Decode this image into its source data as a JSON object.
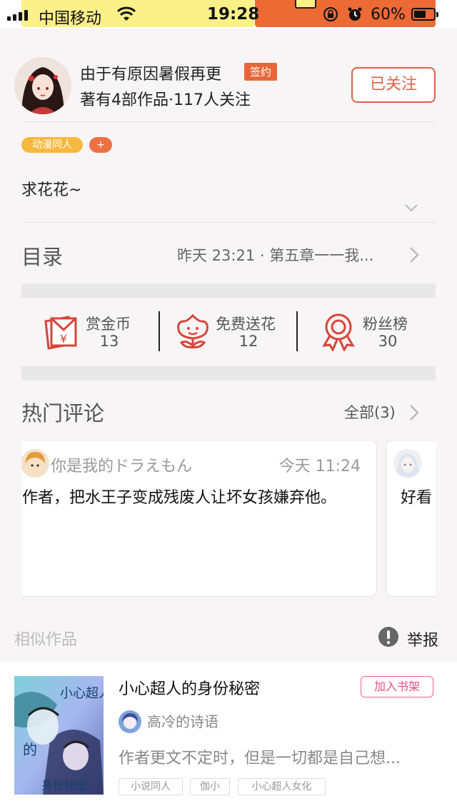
{
  "status_bar": {
    "carrier": "中国移动",
    "time": "19:28",
    "battery": "60%",
    "battery_level": 0.6
  },
  "author": {
    "name": "由于有原因暑假再更",
    "badge": "签约",
    "stats": "著有4部作品·117人关注",
    "follow_label": "已关注"
  },
  "tags": [
    "动漫同人",
    "+"
  ],
  "description": "求花花~",
  "toc": {
    "title": "目录",
    "latest": "昨天 23:21 · 第五章一一我..."
  },
  "actions": [
    {
      "icon": "red-envelope-icon",
      "label": "赏金币",
      "value": "13"
    },
    {
      "icon": "flower-icon",
      "label": "免费送花",
      "value": "12"
    },
    {
      "icon": "medal-icon",
      "label": "粉丝榜",
      "value": "30"
    }
  ],
  "hot_comments": {
    "title": "热门评论",
    "all_label": "全部(3)",
    "items": [
      {
        "user": "你是我的ドラえもん",
        "time": "今天 11:24",
        "text": "作者，把水王子变成残废人让坏女孩嫌弃他。"
      },
      {
        "user": "",
        "time": "",
        "text": "好看"
      }
    ]
  },
  "similar": {
    "title": "相似作品",
    "report_label": "举报",
    "book": {
      "title": "小心超人的身份秘密",
      "shelf_label": "加入书架",
      "author": "高冷的诗语",
      "desc": "作者更文不定时，但是一切都是自己想...",
      "tags": [
        "小说同人",
        "伽小",
        "小心超人女化"
      ],
      "cover_text": [
        "小心超人",
        "的",
        "身份秘密"
      ]
    }
  },
  "colors": {
    "accent": "#e06148",
    "badge": "#e8673a",
    "tag_yellow": "#f7b83f",
    "shelf_pink": "#e64f85"
  }
}
